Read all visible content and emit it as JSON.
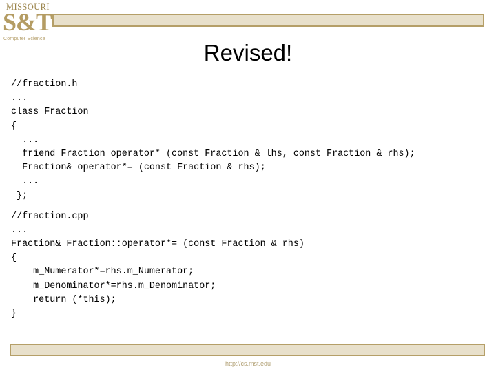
{
  "header": {
    "logo": {
      "university": "MISSOURI",
      "mark": "S&T",
      "department": "Computer Science"
    }
  },
  "title": "Revised!",
  "code": {
    "blocks": [
      {
        "name": "header-file",
        "lines": [
          "//fraction.h",
          "...",
          "class Fraction",
          "{",
          "  ...",
          "  friend Fraction operator* (const Fraction & lhs, const Fraction & rhs);",
          "  Fraction& operator*= (const Fraction & rhs);",
          "  ...",
          " };"
        ]
      },
      {
        "name": "source-file",
        "lines": [
          "//fraction.cpp",
          "...",
          "Fraction& Fraction::operator*= (const Fraction & rhs)",
          "{",
          "    m_Numerator*=rhs.m_Numerator;",
          "    m_Denominator*=rhs.m_Denominator;",
          "    return (*this);",
          "}"
        ]
      }
    ]
  },
  "footer": {
    "url": "http://cs.mst.edu"
  },
  "colors": {
    "accent_gold": "#b59f68",
    "bar_fill": "#e8e0cb",
    "logo_gold": "#b49c63",
    "footer_text": "#b2a175"
  }
}
